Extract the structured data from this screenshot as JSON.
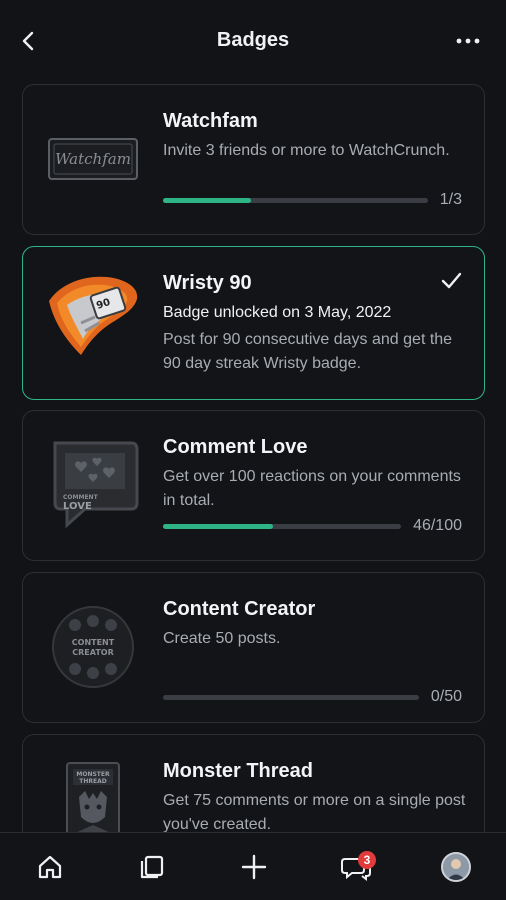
{
  "header": {
    "title": "Badges"
  },
  "badges": [
    {
      "title": "Watchfam",
      "description": "Invite 3 friends or more to WatchCrunch.",
      "progress": 0.3333,
      "count": "1/3",
      "image_text": "Watchfam",
      "unlocked": false
    },
    {
      "title": "Wristy 90",
      "unlocked_text": "Badge unlocked on 3 May, 2022",
      "description": "Post  for 90 consecutive days and get the 90 day streak Wristy badge.",
      "image_text": "90",
      "unlocked": true
    },
    {
      "title": "Comment Love",
      "description": "Get over 100 reactions on your comments in total.",
      "progress": 0.46,
      "count": "46/100",
      "image_text_line1": "COMMENT",
      "image_text_line2": "LOVE",
      "unlocked": false
    },
    {
      "title": "Content Creator",
      "description": "Create 50 posts.",
      "progress": 0.0,
      "count": "0/50",
      "image_text_line1": "CONTENT",
      "image_text_line2": "CREATOR",
      "unlocked": false
    },
    {
      "title": "Monster Thread",
      "description": "Get 75 comments or more on a single post you've created.",
      "image_text_line1": "MONSTER",
      "image_text_line2": "THREAD",
      "unlocked": false
    }
  ],
  "bottom_nav": {
    "items": [
      {
        "icon": "home-icon"
      },
      {
        "icon": "posts-icon"
      },
      {
        "icon": "plus-icon"
      },
      {
        "icon": "messages-icon",
        "badge": "3"
      },
      {
        "icon": "profile-avatar"
      }
    ]
  },
  "colors": {
    "accent": "#2fb585",
    "background": "#111316",
    "notification": "#e23b3b"
  }
}
